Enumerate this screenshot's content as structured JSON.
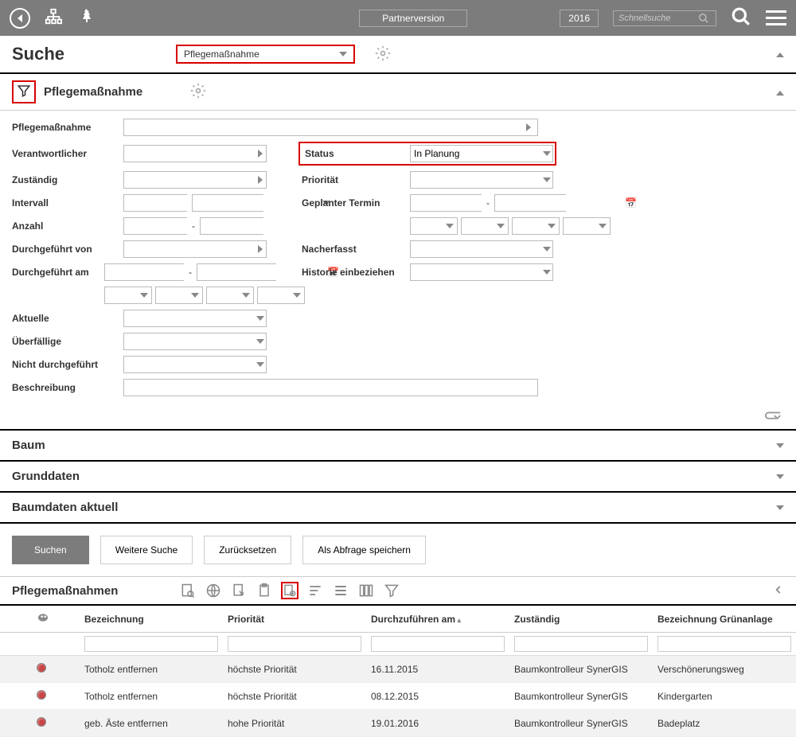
{
  "header": {
    "partner_btn": "Partnerversion",
    "year": "2016",
    "quick_search_placeholder": "Schnellsuche"
  },
  "search": {
    "title": "Suche",
    "dropdown_value": "Pflegemaßnahme"
  },
  "filter_section": {
    "title": "Pflegemaßnahme",
    "labels": {
      "pflege": "Pflegemaßnahme",
      "verantwortlicher": "Verantwortlicher",
      "zustaendig": "Zuständig",
      "intervall": "Intervall",
      "anzahl": "Anzahl",
      "durchgefuehrt_von": "Durchgeführt von",
      "durchgefuehrt_am": "Durchgeführt am",
      "aktuelle": "Aktuelle",
      "ueberfaellige": "Überfällige",
      "nicht_durchgefuehrt": "Nicht durchgeführt",
      "beschreibung": "Beschreibung",
      "status": "Status",
      "status_value": "In Planung",
      "prioritaet": "Priorität",
      "geplanter_termin": "Geplanter Termin",
      "nacherfasst": "Nacherfasst",
      "historie": "Historie einbeziehen"
    }
  },
  "accordions": {
    "baum": "Baum",
    "grunddaten": "Grunddaten",
    "baumdaten": "Baumdaten aktuell"
  },
  "buttons": {
    "suchen": "Suchen",
    "weitere": "Weitere Suche",
    "reset": "Zurücksetzen",
    "save_query": "Als Abfrage speichern"
  },
  "results": {
    "title": "Pflegemaßnahmen",
    "columns": {
      "bezeichnung": "Bezeichnung",
      "prioritaet": "Priorität",
      "durchzufuehren": "Durchzuführen am",
      "zustaendig": "Zuständig",
      "gruenanlage": "Bezeichnung Grünanlage"
    },
    "rows": [
      {
        "bez": "Totholz entfernen",
        "prio": "höchste Priorität",
        "datum": "16.11.2015",
        "zust": "Baumkontrolleur SynerGIS",
        "ga": "Verschönerungsweg"
      },
      {
        "bez": "Totholz entfernen",
        "prio": "höchste Priorität",
        "datum": "08.12.2015",
        "zust": "Baumkontrolleur SynerGIS",
        "ga": "Kindergarten"
      },
      {
        "bez": "geb. Äste entfernen",
        "prio": "hohe Priorität",
        "datum": "19.01.2016",
        "zust": "Baumkontrolleur SynerGIS",
        "ga": "Badeplatz"
      }
    ]
  }
}
